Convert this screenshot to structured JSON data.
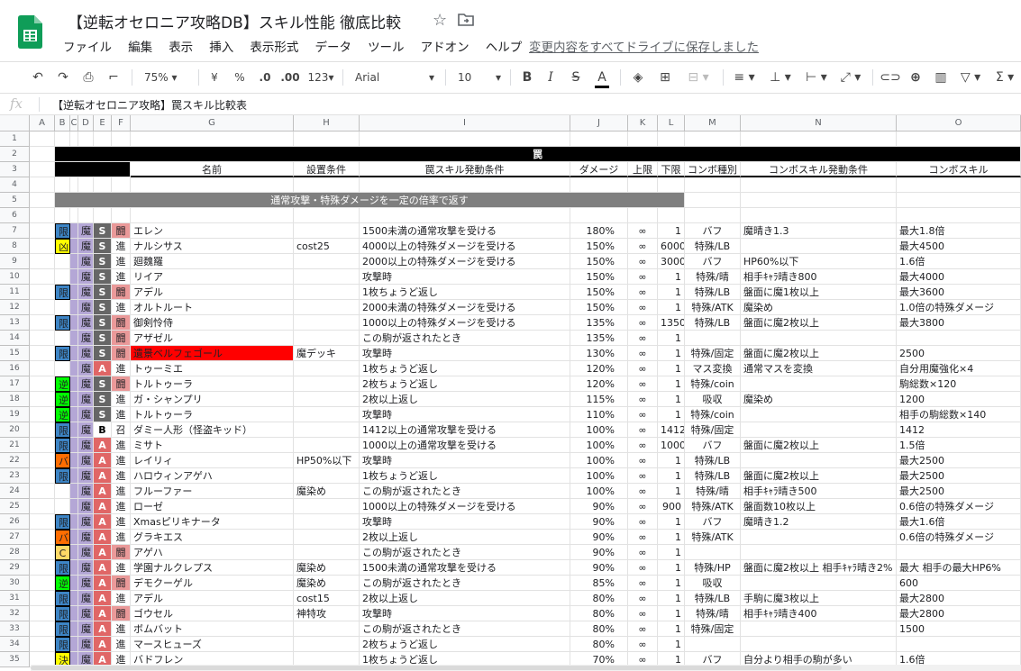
{
  "app": {
    "title": "【逆転オセロニア攻略DB】スキル性能 徹底比較",
    "save_status": "変更内容をすべてドライブに保存しました",
    "menu": [
      "ファイル",
      "編集",
      "表示",
      "挿入",
      "表示形式",
      "データ",
      "ツール",
      "アドオン",
      "ヘルプ"
    ]
  },
  "toolbar": {
    "zoom": "75%",
    "currency": "¥",
    "percent": "%",
    "dec_less": ".0",
    "dec_more": ".00",
    "format": "123",
    "font": "Arial",
    "size": "10",
    "bold": "B",
    "italic": "I",
    "strike": "S",
    "textcolor": "A"
  },
  "formula_bar": {
    "fx": "fx",
    "content": "【逆転オセロニア攻略】罠スキル比較表"
  },
  "columns": [
    "A",
    "B",
    "C",
    "D",
    "E",
    "F",
    "G",
    "H",
    "I",
    "J",
    "K",
    "L",
    "M",
    "N",
    "O"
  ],
  "sheet": {
    "title_row": "罠",
    "headers": [
      "名前",
      "設置条件",
      "罠スキル発動条件",
      "ダメージ",
      "上限",
      "下限",
      "コンボ種別",
      "コンボスキル発動条件",
      "コンボスキル"
    ],
    "section_label": "通常攻撃・特殊ダメージを一定の倍率で返す"
  },
  "rows": [
    {
      "n": 7,
      "b": "限",
      "d": "魔",
      "e": "S",
      "f": "闘",
      "g": "エレン",
      "h": "",
      "i": "1500未満の通常攻撃を受ける",
      "j": "180%",
      "k": "∞",
      "l": "1",
      "m": "バフ",
      "nn": "魔晴き1.3",
      "o": "最大1.8倍"
    },
    {
      "n": 8,
      "b": "凶",
      "d": "魔",
      "e": "S",
      "f": "進",
      "g": "ナルシサス",
      "h": "cost25",
      "i": "4000以上の特殊ダメージを受ける",
      "j": "150%",
      "k": "∞",
      "l": "6000",
      "m": "特殊/LB",
      "nn": "",
      "o": "最大4500"
    },
    {
      "n": 9,
      "b": "",
      "d": "魔",
      "e": "S",
      "f": "進",
      "g": "廻魏羅",
      "h": "",
      "i": "2000以上の特殊ダメージを受ける",
      "j": "150%",
      "k": "∞",
      "l": "3000",
      "m": "バフ",
      "nn": "HP60%以下",
      "o": "1.6倍"
    },
    {
      "n": 10,
      "b": "",
      "d": "魔",
      "e": "S",
      "f": "進",
      "g": "リイア",
      "h": "",
      "i": "攻撃時",
      "j": "150%",
      "k": "∞",
      "l": "1",
      "m": "特殊/晴",
      "nn": "相手ｷｬﾗ晴き800",
      "o": "最大4000"
    },
    {
      "n": 11,
      "b": "限",
      "d": "魔",
      "e": "S",
      "f": "闘",
      "g": "アデル",
      "h": "",
      "i": "1枚ちょうど返し",
      "j": "150%",
      "k": "∞",
      "l": "1",
      "m": "特殊/LB",
      "nn": "盤面に魔1枚以上",
      "o": "最大3600"
    },
    {
      "n": 12,
      "b": "",
      "d": "魔",
      "e": "S",
      "f": "進",
      "g": "オルトルート",
      "h": "",
      "i": "2000未満の特殊ダメージを受ける",
      "j": "150%",
      "k": "∞",
      "l": "1",
      "m": "特殊/ATK",
      "nn": "魔染め",
      "o": "1.0倍の特殊ダメージ"
    },
    {
      "n": 13,
      "b": "限",
      "d": "魔",
      "e": "S",
      "f": "闘",
      "g": "御剣怜侍",
      "h": "",
      "i": "1000以上の特殊ダメージを受ける",
      "j": "135%",
      "k": "∞",
      "l": "1350",
      "m": "特殊/LB",
      "nn": "盤面に魔2枚以上",
      "o": "最大3800"
    },
    {
      "n": 14,
      "b": "",
      "d": "魔",
      "e": "S",
      "f": "闘",
      "g": "アザゼル",
      "h": "",
      "i": "この駒が返されたとき",
      "j": "135%",
      "k": "∞",
      "l": "1",
      "m": "",
      "nn": "",
      "o": ""
    },
    {
      "n": 15,
      "b": "限",
      "d": "魔",
      "e": "S",
      "f": "闘",
      "g": "遺景ベルフェゴール",
      "h": "魔デッキ",
      "i": "攻撃時",
      "j": "130%",
      "k": "∞",
      "l": "1",
      "m": "特殊/固定",
      "nn": "盤面に魔2枚以上",
      "o": "2500",
      "red": true
    },
    {
      "n": 16,
      "b": "",
      "d": "魔",
      "e": "A",
      "f": "進",
      "g": "トゥーミエ",
      "h": "",
      "i": "1枚ちょうど返し",
      "j": "120%",
      "k": "∞",
      "l": "1",
      "m": "マス変換",
      "nn": "通常マスを変換",
      "o": "自分用魔強化×4"
    },
    {
      "n": 17,
      "b": "逆",
      "d": "魔",
      "e": "S",
      "f": "闘",
      "g": "トルトゥーラ",
      "h": "",
      "i": "2枚ちょうど返し",
      "j": "120%",
      "k": "∞",
      "l": "1",
      "m": "特殊/coin",
      "nn": "",
      "o": "駒総数×120"
    },
    {
      "n": 18,
      "b": "逆",
      "d": "魔",
      "e": "S",
      "f": "進",
      "g": "ガ・シャンプリ",
      "h": "",
      "i": "2枚以上返し",
      "j": "115%",
      "k": "∞",
      "l": "1",
      "m": "吸収",
      "nn": "魔染め",
      "o": "1200"
    },
    {
      "n": 19,
      "b": "逆",
      "d": "魔",
      "e": "S",
      "f": "進",
      "g": "トルトゥーラ",
      "h": "",
      "i": "攻撃時",
      "j": "110%",
      "k": "∞",
      "l": "1",
      "m": "特殊/coin",
      "nn": "",
      "o": "相手の駒総数×140"
    },
    {
      "n": 20,
      "b": "限",
      "d": "魔",
      "e": "B",
      "f": "召",
      "g": "ダミー人形（怪盗キッド）",
      "h": "",
      "i": "1412以上の通常攻撃を受ける",
      "j": "100%",
      "k": "∞",
      "l": "1412",
      "m": "特殊/固定",
      "nn": "",
      "o": "1412"
    },
    {
      "n": 21,
      "b": "限",
      "d": "魔",
      "e": "A",
      "f": "進",
      "g": "ミサト",
      "h": "",
      "i": "1000以上の通常攻撃を受ける",
      "j": "100%",
      "k": "∞",
      "l": "1000",
      "m": "バフ",
      "nn": "盤面に魔2枚以上",
      "o": "1.5倍"
    },
    {
      "n": 22,
      "b": "バ",
      "d": "魔",
      "e": "A",
      "f": "進",
      "g": "レイリィ",
      "h": "HP50%以下",
      "i": "攻撃時",
      "j": "100%",
      "k": "∞",
      "l": "1",
      "m": "特殊/LB",
      "nn": "",
      "o": "最大2500"
    },
    {
      "n": 23,
      "b": "限",
      "d": "魔",
      "e": "A",
      "f": "進",
      "g": "ハロウィンアゲハ",
      "h": "",
      "i": "1枚ちょうど返し",
      "j": "100%",
      "k": "∞",
      "l": "1",
      "m": "特殊/LB",
      "nn": "盤面に魔2枚以上",
      "o": "最大2500"
    },
    {
      "n": 24,
      "b": "",
      "d": "魔",
      "e": "A",
      "f": "進",
      "g": "フルーファー",
      "h": "魔染め",
      "i": "この駒が返されたとき",
      "j": "100%",
      "k": "∞",
      "l": "1",
      "m": "特殊/晴",
      "nn": "相手ｷｬﾗ晴き500",
      "o": "最大2500"
    },
    {
      "n": 25,
      "b": "",
      "d": "魔",
      "e": "A",
      "f": "進",
      "g": "ローゼ",
      "h": "",
      "i": "1000以上の特殊ダメージを受ける",
      "j": "90%",
      "k": "∞",
      "l": "900",
      "m": "特殊/ATK",
      "nn": "盤面数10枚以上",
      "o": "0.6倍の特殊ダメージ"
    },
    {
      "n": 26,
      "b": "限",
      "d": "魔",
      "e": "A",
      "f": "進",
      "g": "Xmasピリキナータ",
      "h": "",
      "i": "攻撃時",
      "j": "90%",
      "k": "∞",
      "l": "1",
      "m": "バフ",
      "nn": "魔晴き1.2",
      "o": "最大1.6倍"
    },
    {
      "n": 27,
      "b": "バ",
      "d": "魔",
      "e": "A",
      "f": "進",
      "g": "グラキエス",
      "h": "",
      "i": "2枚以上返し",
      "j": "90%",
      "k": "∞",
      "l": "1",
      "m": "特殊/ATK",
      "nn": "",
      "o": "0.6倍の特殊ダメージ"
    },
    {
      "n": 28,
      "b": "C",
      "d": "魔",
      "e": "A",
      "f": "闘",
      "g": "アゲハ",
      "h": "",
      "i": "この駒が返されたとき",
      "j": "90%",
      "k": "∞",
      "l": "1",
      "m": "",
      "nn": "",
      "o": ""
    },
    {
      "n": 29,
      "b": "限",
      "d": "魔",
      "e": "A",
      "f": "進",
      "g": "学園ナルクレプス",
      "h": "魔染め",
      "i": "1500未満の通常攻撃を受ける",
      "j": "90%",
      "k": "∞",
      "l": "1",
      "m": "特殊/HP",
      "nn": "盤面に魔2枚以上 相手ｷｬﾗ晴き2%",
      "o": "最大 相手の最大HP6%"
    },
    {
      "n": 30,
      "b": "逆",
      "d": "魔",
      "e": "A",
      "f": "闘",
      "g": "デモクーゲル",
      "h": "魔染め",
      "i": "この駒が返されたとき",
      "j": "85%",
      "k": "∞",
      "l": "1",
      "m": "吸収",
      "nn": "",
      "o": "600"
    },
    {
      "n": 31,
      "b": "限",
      "d": "魔",
      "e": "A",
      "f": "進",
      "g": "アデル",
      "h": "cost15",
      "i": "2枚以上返し",
      "j": "80%",
      "k": "∞",
      "l": "1",
      "m": "特殊/LB",
      "nn": "手駒に魔3枚以上",
      "o": "最大2800"
    },
    {
      "n": 32,
      "b": "限",
      "d": "魔",
      "e": "A",
      "f": "闘",
      "g": "ゴウセル",
      "h": "神特攻",
      "i": "攻撃時",
      "j": "80%",
      "k": "∞",
      "l": "1",
      "m": "特殊/晴",
      "nn": "相手ｷｬﾗ晴き400",
      "o": "最大2800"
    },
    {
      "n": 33,
      "b": "限",
      "d": "魔",
      "e": "A",
      "f": "進",
      "g": "ボムバット",
      "h": "",
      "i": "この駒が返されたとき",
      "j": "80%",
      "k": "∞",
      "l": "1",
      "m": "特殊/固定",
      "nn": "",
      "o": "1500"
    },
    {
      "n": 34,
      "b": "限",
      "d": "魔",
      "e": "A",
      "f": "進",
      "g": "マースヒューズ",
      "h": "",
      "i": "2枚ちょうど返し",
      "j": "80%",
      "k": "∞",
      "l": "1",
      "m": "",
      "nn": "",
      "o": ""
    },
    {
      "n": 35,
      "b": "決",
      "d": "魔",
      "e": "A",
      "f": "進",
      "g": "バドフレン",
      "h": "",
      "i": "1枚ちょうど返し",
      "j": "70%",
      "k": "∞",
      "l": "1",
      "m": "バフ",
      "nn": "自分より相手の駒が多い",
      "o": "1.6倍"
    }
  ],
  "colors": {
    "header_black": "#000000",
    "section_gray": "#7f7f7f",
    "gen": "#3d85c6",
    "kyo": "#ffff00",
    "gyaku": "#00ff00",
    "ba": "#ff6d01",
    "c": "#ffd966",
    "ketsu": "#ffff00",
    "ma": "#b4a7d6",
    "rank_s": "#666666",
    "rank_a": "#e06666",
    "rank_b": "#ffffff",
    "type_to": "#ea9999",
    "type_shin": "#ffffff",
    "red_cell": "#ff0000"
  }
}
